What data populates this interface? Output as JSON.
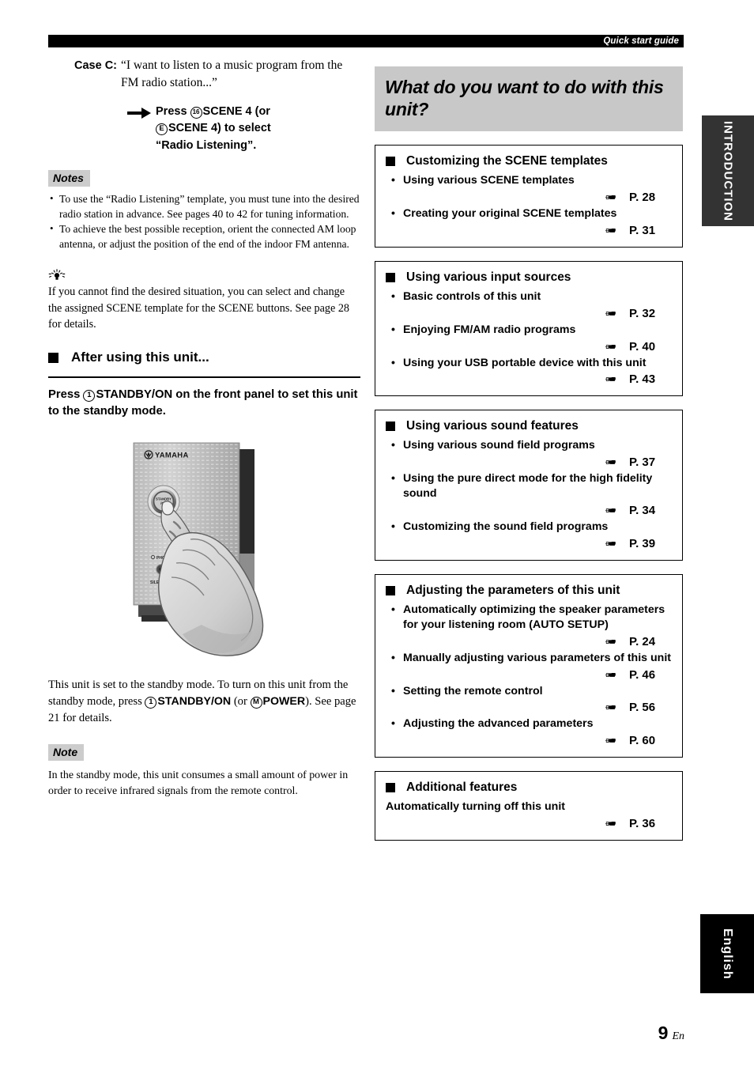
{
  "header": {
    "running_title": "Quick start guide"
  },
  "side_tabs": {
    "introduction": "INTRODUCTION",
    "english": "English"
  },
  "footer": {
    "page_number": "9",
    "page_suffix": "En"
  },
  "left_column": {
    "case": {
      "label": "Case C:",
      "text": "“I want to listen to a music program from the FM radio station...”"
    },
    "press_instruction": {
      "arrow_icon": "right-arrow-icon",
      "line1_pre": "Press ",
      "line1_circle": "16",
      "line1_post": "SCENE 4 (or",
      "line2_circle": "E",
      "line2_post": "SCENE 4) to select",
      "line3": "“Radio Listening”."
    },
    "notes_label": "Notes",
    "notes": [
      "To use the “Radio Listening” template, you must tune into the desired radio station in advance. See pages 40 to 42 for tuning information.",
      "To achieve the best possible reception, orient the connected AM loop antenna, or adjust the position of the end of the indoor FM antenna."
    ],
    "tip": {
      "icon": "lightbulb-tip-icon",
      "text": "If you cannot find the desired situation, you can select and change the assigned SCENE template for the SCENE buttons. See page 28 for details."
    },
    "section_heading": "After using this unit...",
    "instruction": {
      "pre": "Press ",
      "circle": "1",
      "bold": "STANDBY/ON",
      "post": " on the front panel to set this unit to the standby mode."
    },
    "illustration": {
      "name": "front-panel-standby-press-illustration",
      "brand": "YAMAHA",
      "button_label": "STANDBY /ON",
      "phones_label": "PHONES",
      "silent_cinema_label": "SILENT CINEMA"
    },
    "body_paragraph": {
      "part1": "This unit is set to the standby mode. To turn on this unit from the standby mode, press ",
      "circle1": "1",
      "bold1": "STANDBY/ON",
      "part2": " (or ",
      "circle2": "M",
      "bold2": "POWER",
      "part3": "). See page 21 for details."
    },
    "note_label": "Note",
    "note_body": "In the standby mode, this unit consumes a small amount of power in order to receive infrared signals from the remote control."
  },
  "right_column": {
    "title": "What do you want to do with this unit?",
    "cards": [
      {
        "heading": "Customizing the SCENE templates",
        "entries": [
          {
            "text": "Using various SCENE templates",
            "page": "P. 28",
            "bullet": true
          },
          {
            "text": "Creating your original SCENE templates",
            "page": "P. 31",
            "bullet": true
          }
        ]
      },
      {
        "heading": "Using various input sources",
        "entries": [
          {
            "text": "Basic controls of this unit",
            "page": "P. 32",
            "bullet": true
          },
          {
            "text": "Enjoying FM/AM radio programs",
            "page": "P. 40",
            "bullet": true
          },
          {
            "text": "Using your USB portable device with this unit",
            "page": "P. 43",
            "bullet": true
          }
        ]
      },
      {
        "heading": "Using various sound features",
        "entries": [
          {
            "text": "Using various sound field programs",
            "page": "P. 37",
            "bullet": true
          },
          {
            "text": "Using the pure direct mode for the high fidelity sound",
            "page": "P. 34",
            "bullet": true
          },
          {
            "text": "Customizing the sound field programs",
            "page": "P. 39",
            "bullet": true
          }
        ]
      },
      {
        "heading": "Adjusting the parameters of this unit",
        "entries": [
          {
            "text": "Automatically optimizing the speaker parameters for your listening room (AUTO SETUP)",
            "page": "P. 24",
            "bullet": true
          },
          {
            "text": "Manually adjusting various parameters of this unit",
            "page": "P. 46",
            "bullet": true
          },
          {
            "text": "Setting the remote control",
            "page": "P. 56",
            "bullet": true
          },
          {
            "text": "Adjusting the advanced parameters",
            "page": "P. 60",
            "bullet": true
          }
        ]
      },
      {
        "heading": "Additional features",
        "entries": [
          {
            "text": "Automatically turning off this unit",
            "page": "P. 36",
            "bullet": false
          }
        ]
      }
    ]
  }
}
